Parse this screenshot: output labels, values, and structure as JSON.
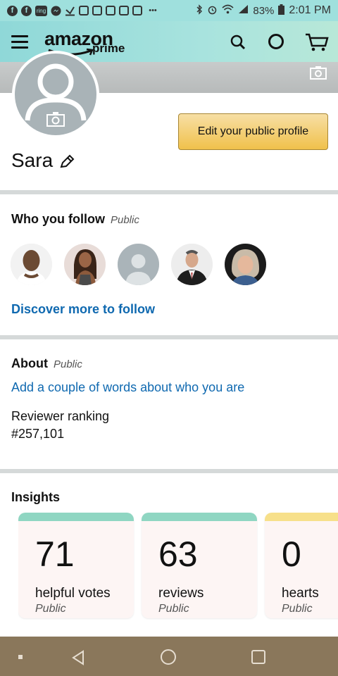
{
  "status_bar": {
    "battery": "83%",
    "time": "2:01 PM",
    "left_icons": [
      "facebook-icon",
      "facebook-icon",
      "ring-icon",
      "messenger-icon",
      "download-icon",
      "mail-icon",
      "instagram-icon",
      "instagram-icon",
      "instagram-icon",
      "instagram-icon",
      "more-icon"
    ],
    "ring_label": "ring",
    "more_label": "•••"
  },
  "header": {
    "logo_text": "amazon",
    "logo_sub": "prime",
    "accent": "#9fe0dd"
  },
  "profile": {
    "name": "Sara",
    "edit_button": "Edit your public profile"
  },
  "follow": {
    "title": "Who you follow",
    "visibility": "Public",
    "avatars": [
      "person-1",
      "person-2",
      "person-3-placeholder",
      "person-4",
      "person-5"
    ],
    "discover_link": "Discover more to follow"
  },
  "about": {
    "title": "About",
    "visibility": "Public",
    "add_words_link": "Add a couple of words about who you are",
    "ranking_label": "Reviewer ranking",
    "ranking_value": "#257,101"
  },
  "insights": {
    "title": "Insights",
    "cards": [
      {
        "value": "71",
        "label": "helpful votes",
        "visibility": "Public",
        "accent": "#8fd6c2"
      },
      {
        "value": "63",
        "label": "reviews",
        "visibility": "Public",
        "accent": "#8fd6c2"
      },
      {
        "value": "0",
        "label": "hearts",
        "visibility": "Public",
        "accent": "#f7e08a"
      }
    ]
  },
  "colors": {
    "link": "#0f69b0",
    "button": "#f0c14b",
    "nav_bar": "#8a775b"
  }
}
